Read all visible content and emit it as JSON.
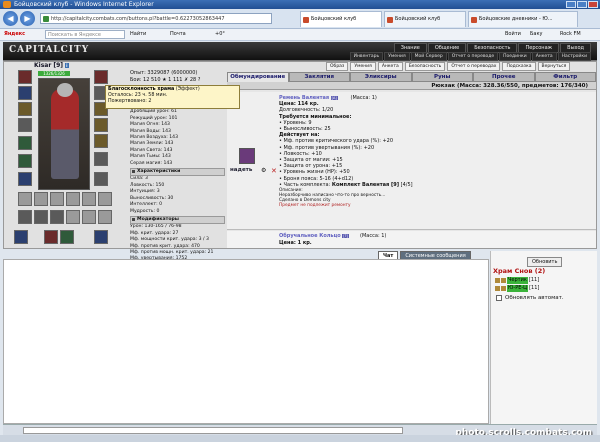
{
  "window": {
    "title": "Бойцовский клуб - Windows Internet Explorer"
  },
  "browser": {
    "url": "http://capitalcity.combats.com/buttons.pl?battle=0.62273052863447",
    "tabs": [
      "Бойцовский клуб",
      "Бойцовский клуб",
      "Бойцовские дневники - Ю..."
    ],
    "search_placeholder": "Поискать в Яндексе",
    "find_label": "Найти",
    "mail_label": "Почта",
    "weather": "+0°",
    "right_items": [
      "Войти",
      "Баку",
      "Rock FM"
    ]
  },
  "game": {
    "logo": "CAPITALCITY",
    "menu": [
      "Знание",
      "Общение",
      "Безопасность",
      "Персонаж",
      "Выход"
    ],
    "submenu": [
      "Инвентарь",
      "Умения",
      "Мой Сервер",
      "Отчет о переводе",
      "Поединки",
      "Анкета",
      "Настройки"
    ],
    "subtop": [
      "Образ",
      "Умения",
      "Анкета",
      "Безопасность",
      "Отчет о переводах",
      "Подсказка",
      "Вернуться"
    ]
  },
  "character": {
    "name": "Kisar",
    "level": "[9]",
    "hp": "1326/1326",
    "exp": "Опыт: 3329087 (6000000)",
    "battles": "Бои: 12 510 ★ 1 111 ✗ 28 ?",
    "stats": [
      "Рубящий урон: 94",
      "Дробящий урон: 61",
      "Режущий урон: 101",
      "Магия Огня: 143",
      "Магия Воды: 143",
      "Магия Воздуха: 143",
      "Магия Земли: 143",
      "Магия Света: 143",
      "Магия Тьмы: 143",
      "Серая магия: 143"
    ],
    "char_header": "Характеристики",
    "attributes": [
      "Сила: 3",
      "Ловкость: 150",
      "Интуиция: 3",
      "Выносливость: 30",
      "Интеллект: 0",
      "Мудрость: 0"
    ],
    "mod_header": "Модификаторы",
    "modifiers": [
      "Урон: 130-165 / 76-98",
      "Мф. крит. удара: 27",
      "Мф. мощности крит. удара: 3 / 3",
      "Мф. против крит. удара: 470",
      "Мф. против мощн. крит. удара: 21",
      "Мф. увертывания: 1752"
    ]
  },
  "tooltip": {
    "name": "Благосклонность храма",
    "effect": "(Эффект)",
    "remaining": "Осталось: 23 ч. 58 мин.",
    "donated": "Пожертвовано: 2"
  },
  "inventory": {
    "tabs": [
      "Обмундирование",
      "Заклятия",
      "Эликсиры",
      "Руны",
      "Прочее",
      "Фильтр"
    ],
    "backpack": "Рюкзак (Масса: 328.36/550, предметов: 176/340)",
    "use_label": "надеть",
    "item1": {
      "name": "Ремень Валентая",
      "tag": "[A]",
      "mass": "(Масса: 1)",
      "price": "Цена: 114 кр.",
      "durability": "Долговечность: 1/20",
      "req_header": "Требуется минимальное:",
      "reqs": [
        "• Уровень: 9",
        "• Выносливость: 25"
      ],
      "acts_header": "Действует на:",
      "acts": [
        "• Мф. против критического удара (%): +20",
        "• Мф. против увертывания (%): +20",
        "• Ловкость: +10",
        "• Защита от магии: +15",
        "• Защита от урона: +15",
        "• Уровень жизни (HP): +50",
        "• Броня пояса: 5-16 (4+d12)"
      ],
      "set_label": "• Часть комплекта:",
      "set_name": "Комплект Валентая [9]",
      "set_count": "[4/5]",
      "desc_header": "Описание:",
      "desc": "Неразборчиво написано что-то про верность...",
      "made": "Сделано в Demons city",
      "warning": "Предмет не подлежит ремонту"
    },
    "item2": {
      "name": "Обручальное Кольцо",
      "tag": "[?]",
      "mass": "(Масса: 1)",
      "price": "Цена: 1 кр."
    }
  },
  "chat": {
    "tabs": [
      "Чат",
      "Системные сообщения"
    ],
    "refresh": "Обновить",
    "room": "Храм Снов (2)",
    "users": [
      {
        "name": "Чертик",
        "level": "[11]"
      },
      {
        "name": "Ю-РЕ-Ц",
        "level": "[11]"
      }
    ],
    "auto_update": "Обновлять автомат."
  },
  "watermark": "photo.scrolls.combats.com"
}
